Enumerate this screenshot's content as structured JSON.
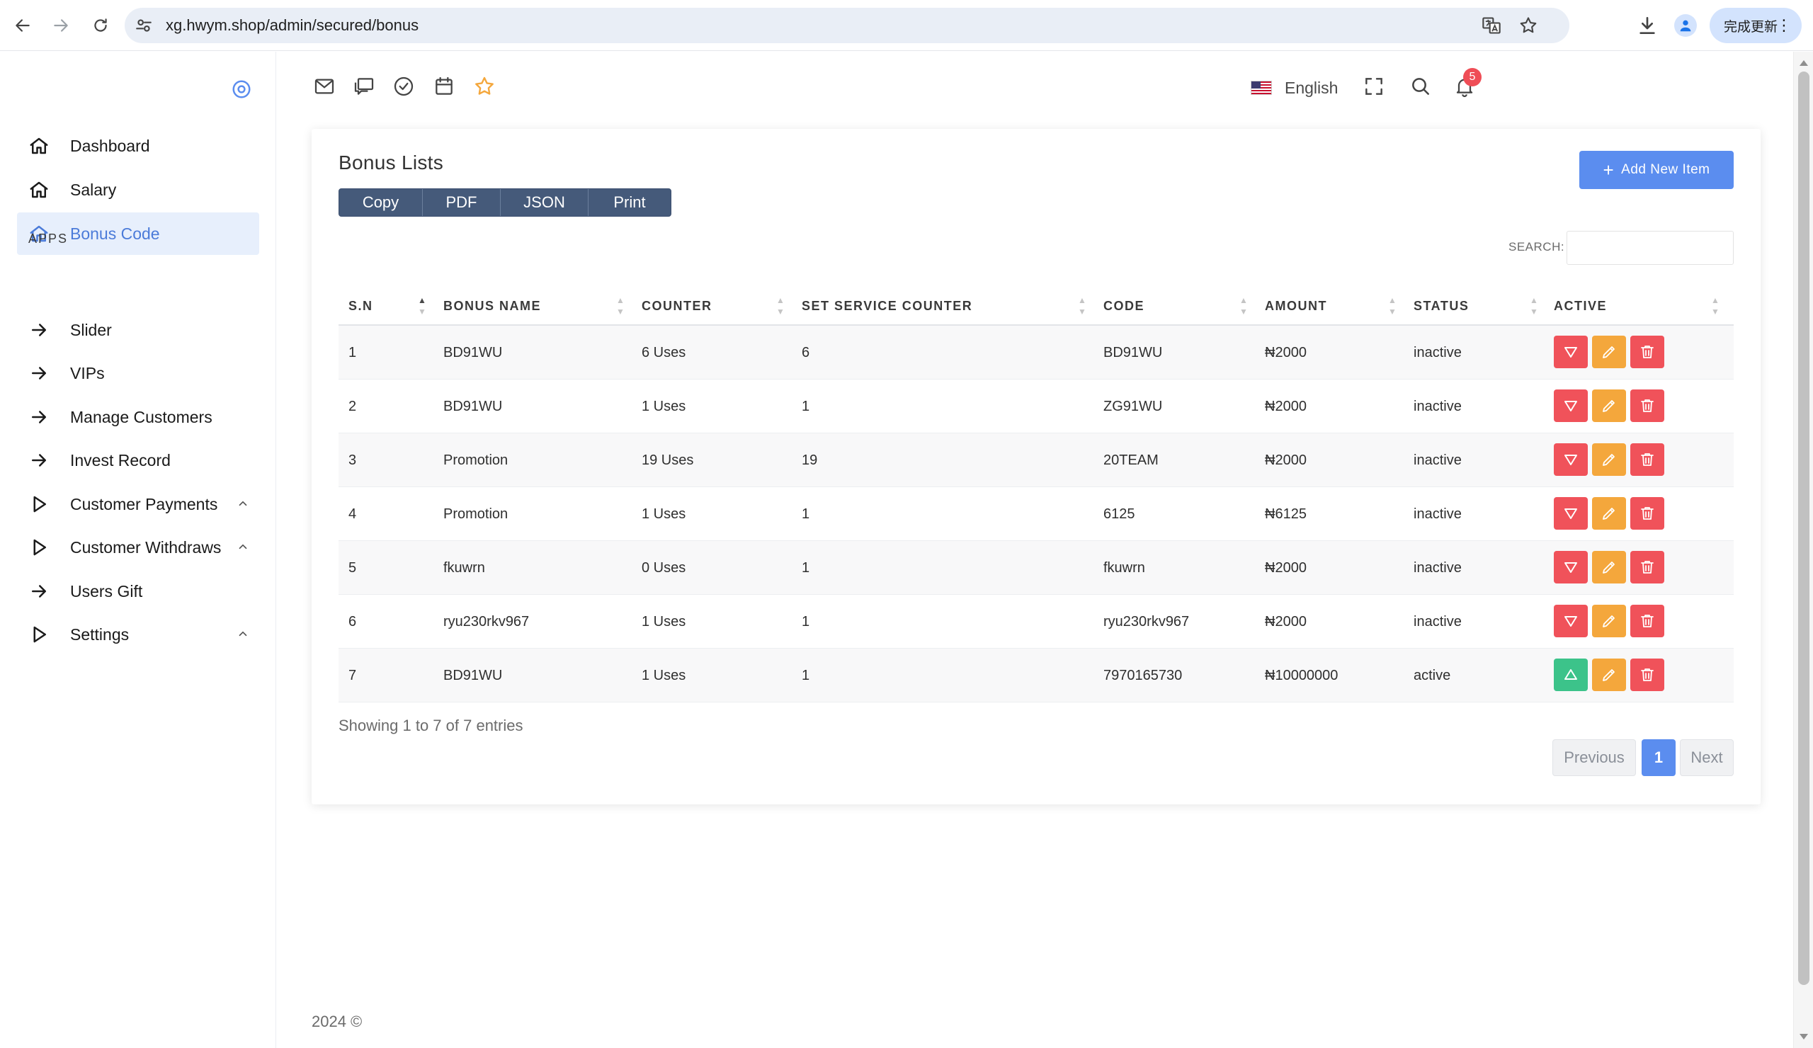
{
  "browser": {
    "url": "xg.hwym.shop/admin/secured/bonus",
    "update_label": "完成更新",
    "more_label": "⋮"
  },
  "sidebar": {
    "items_top": [
      {
        "label": "Dashboard",
        "icon": "home-icon"
      },
      {
        "label": "Salary",
        "icon": "home-icon"
      },
      {
        "label": "Bonus Code",
        "icon": "home-icon",
        "active": true
      }
    ],
    "apps_heading": "APPS",
    "items_apps": [
      {
        "label": "Slider",
        "icon": "arrow-right-icon"
      },
      {
        "label": "VIPs",
        "icon": "arrow-right-icon"
      },
      {
        "label": "Manage Customers",
        "icon": "arrow-right-icon"
      },
      {
        "label": "Invest Record",
        "icon": "arrow-right-icon"
      },
      {
        "label": "Customer Payments",
        "icon": "play-outline-icon",
        "expandable": true
      },
      {
        "label": "Customer Withdraws",
        "icon": "play-outline-icon",
        "expandable": true
      },
      {
        "label": "Users Gift",
        "icon": "arrow-right-icon"
      },
      {
        "label": "Settings",
        "icon": "play-outline-icon",
        "expandable": true
      }
    ]
  },
  "header": {
    "language": "English",
    "notification_count": "5"
  },
  "card": {
    "title": "Bonus Lists",
    "add_button": "Add New Item",
    "export_buttons": [
      "Copy",
      "PDF",
      "JSON",
      "Print"
    ],
    "search_label": "SEARCH:",
    "search_value": ""
  },
  "table": {
    "columns": [
      "S.N",
      "BONUS NAME",
      "COUNTER",
      "SET SERVICE COUNTER",
      "CODE",
      "AMOUNT",
      "STATUS",
      "ACTIVE"
    ],
    "rows": [
      {
        "sn": "1",
        "name": "BD91WU",
        "counter": "6 Uses",
        "set_counter": "6",
        "code": "BD91WU",
        "amount": "₦2000",
        "status": "inactive"
      },
      {
        "sn": "2",
        "name": "BD91WU",
        "counter": "1 Uses",
        "set_counter": "1",
        "code": "ZG91WU",
        "amount": "₦2000",
        "status": "inactive"
      },
      {
        "sn": "3",
        "name": "Promotion",
        "counter": "19 Uses",
        "set_counter": "19",
        "code": "20TEAM",
        "amount": "₦2000",
        "status": "inactive"
      },
      {
        "sn": "4",
        "name": "Promotion",
        "counter": "1 Uses",
        "set_counter": "1",
        "code": "6125",
        "amount": "₦6125",
        "status": "inactive"
      },
      {
        "sn": "5",
        "name": "fkuwrn",
        "counter": "0 Uses",
        "set_counter": "1",
        "code": "fkuwrn",
        "amount": "₦2000",
        "status": "inactive"
      },
      {
        "sn": "6",
        "name": "ryu230rkv967",
        "counter": "1 Uses",
        "set_counter": "1",
        "code": "ryu230rkv967",
        "amount": "₦2000",
        "status": "inactive"
      },
      {
        "sn": "7",
        "name": "BD91WU",
        "counter": "1 Uses",
        "set_counter": "1",
        "code": "7970165730",
        "amount": "₦10000000",
        "status": "active"
      }
    ],
    "info": "Showing 1 to 7 of 7 entries",
    "pagination": {
      "previous": "Previous",
      "current": "1",
      "next": "Next"
    }
  },
  "footer": "2024 ©",
  "colors": {
    "accent": "#5b8def",
    "danger": "#f0525a",
    "success": "#3cc38a",
    "warning": "#f4a73c",
    "export_group": "#455a7a"
  }
}
